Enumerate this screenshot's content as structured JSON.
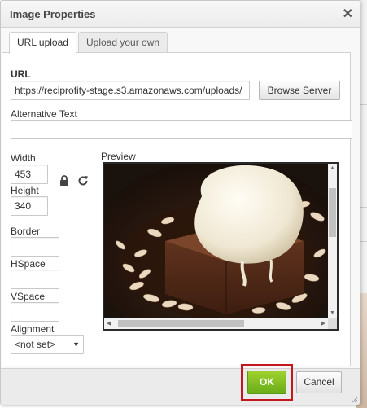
{
  "dialog": {
    "title": "Image Properties",
    "close_icon": "close-icon"
  },
  "tabs": [
    {
      "label": "URL upload",
      "active": true
    },
    {
      "label": "Upload your own",
      "active": false
    }
  ],
  "url": {
    "label": "URL",
    "value": "https://reciprofity-stage.s3.amazonaws.com/uploads/",
    "browse_label": "Browse Server"
  },
  "alt": {
    "label": "Alternative Text",
    "value": ""
  },
  "size": {
    "width_label": "Width",
    "width_value": "453",
    "height_label": "Height",
    "height_value": "340",
    "lock_icon": "lock-icon",
    "reset_icon": "reset-size-icon"
  },
  "border": {
    "label": "Border",
    "value": ""
  },
  "hspace": {
    "label": "HSpace",
    "value": ""
  },
  "vspace": {
    "label": "VSpace",
    "value": ""
  },
  "alignment": {
    "label": "Alignment",
    "selected": "<not set>"
  },
  "preview": {
    "label": "Preview",
    "image": "chocolate-brownie-with-ice-cream-photo"
  },
  "footer": {
    "ok_label": "OK",
    "cancel_label": "Cancel"
  },
  "colors": {
    "ok_green": "#7ab800",
    "highlight_red": "#c4161c",
    "titlebar": "#f0f0f0"
  }
}
